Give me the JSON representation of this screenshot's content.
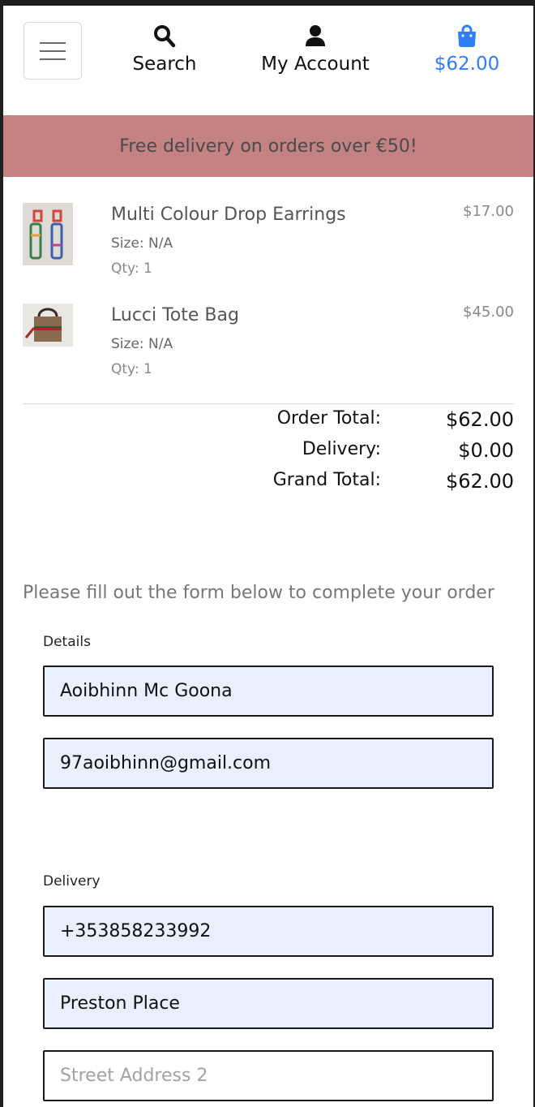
{
  "header": {
    "search_label": "Search",
    "account_label": "My Account",
    "bag_total": "$62.00",
    "icons": {
      "menu": "hamburger-icon",
      "search": "search-icon",
      "account": "user-icon",
      "bag": "shopping-bag-icon"
    },
    "accent_color": "#2f7ef5"
  },
  "banner": {
    "text": "Free delivery on orders over €50!",
    "background": "#c48282"
  },
  "items": [
    {
      "name": "Multi Colour Drop Earrings",
      "size": "Size: N/A",
      "qty": "Qty: 1",
      "price": "$17.00"
    },
    {
      "name": "Lucci Tote Bag",
      "size": "Size: N/A",
      "qty": "Qty: 1",
      "price": "$45.00"
    }
  ],
  "totals": {
    "order_total_label": "Order Total:",
    "order_total_value": "$62.00",
    "delivery_label": "Delivery:",
    "delivery_value": "$0.00",
    "grand_total_label": "Grand Total:",
    "grand_total_value": "$62.00"
  },
  "form": {
    "intro": "Please fill out the form below to complete your order",
    "details_legend": "Details",
    "full_name_value": "Aoibhinn Mc Goona",
    "email_value": "97aoibhinn@gmail.com",
    "delivery_legend": "Delivery",
    "phone_value": "+353858233992",
    "street1_value": "Preston Place",
    "street2_value": "",
    "street2_placeholder": "Street Address 2"
  }
}
